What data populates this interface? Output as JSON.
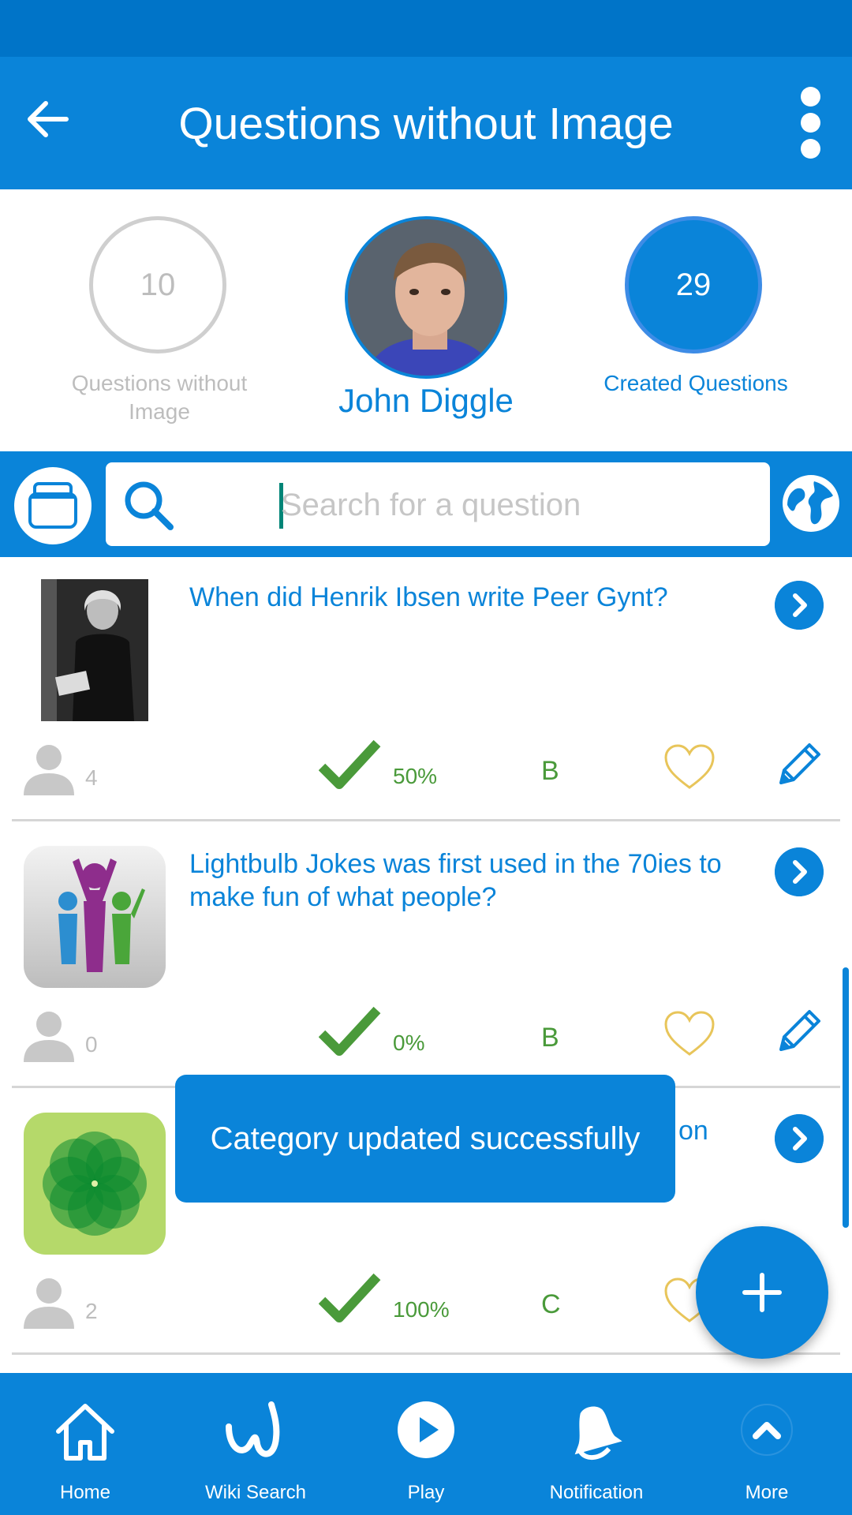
{
  "app_bar": {
    "title": "Questions without Image",
    "back_icon": "arrow-left-icon",
    "menu_icon": "more-vertical-icon"
  },
  "profile": {
    "user_name": "John Diggle",
    "stat_left": {
      "value": "10",
      "label": "Questions without Image"
    },
    "stat_right": {
      "value": "29",
      "label": "Created Questions"
    }
  },
  "search": {
    "placeholder": "Search for a question",
    "value": ""
  },
  "questions": [
    {
      "text": "When did Henrik Ibsen write Peer Gynt?",
      "count": "4",
      "percent": "50%",
      "answer": "B"
    },
    {
      "text": "Lightbulb Jokes was first used in the 70ies to make fun of what people?",
      "count": "0",
      "percent": "0%",
      "answer": "B"
    },
    {
      "text": "on",
      "count": "2",
      "percent": "100%",
      "answer": "C"
    }
  ],
  "toast": {
    "message": "Category updated successfully"
  },
  "fab": {
    "label": "+"
  },
  "bottom_nav": [
    {
      "label": "Home",
      "icon": "home-icon"
    },
    {
      "label": "Wiki Search",
      "icon": "wiki-icon"
    },
    {
      "label": "Play",
      "icon": "play-icon"
    },
    {
      "label": "Notification",
      "icon": "bell-icon"
    },
    {
      "label": "More",
      "icon": "chevron-up-icon"
    }
  ],
  "colors": {
    "primary": "#0a84d9",
    "status_bar": "#0074c8",
    "success": "#4a9a3a",
    "heart": "#e8c55a",
    "muted": "#bdbdbd"
  }
}
